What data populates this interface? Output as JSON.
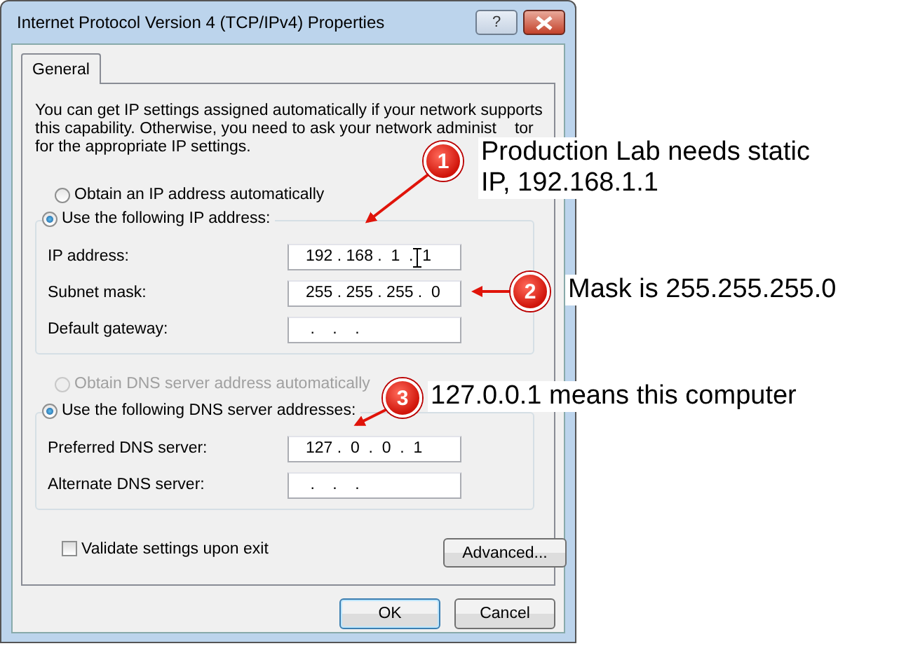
{
  "window": {
    "title": "Internet Protocol Version 4 (TCP/IPv4) Properties",
    "help_button": "?"
  },
  "tabs": [
    {
      "label": "General",
      "selected": true
    }
  ],
  "intro_lines": [
    [
      "You can get IP settings assigned automatically if your network supports"
    ],
    [
      "this capability. Otherwise, you need to ask your network administ",
      "tor"
    ],
    [
      "for the appropriate IP settings."
    ]
  ],
  "ip_mode": [
    {
      "label": "Obtain an IP address automatically",
      "selected": false,
      "disabled": false
    },
    {
      "label": "Use the following IP address:",
      "selected": true,
      "disabled": false
    }
  ],
  "ip_fields": [
    {
      "label": "IP address:",
      "value": "192 . 168 .  1  .  1",
      "cursor": true
    },
    {
      "label": "Subnet mask:",
      "value": "255 . 255 . 255 .  0",
      "cursor": false
    },
    {
      "label": "Default gateway:",
      "value": " .    .    . ",
      "cursor": false
    }
  ],
  "dns_mode": [
    {
      "label": "Obtain DNS server address automatically",
      "selected": false,
      "disabled": true
    },
    {
      "label": "Use the following DNS server addresses:",
      "selected": true,
      "disabled": false
    }
  ],
  "dns_fields": [
    {
      "label": "Preferred DNS server:",
      "value": "127 .  0  .  0  .  1",
      "cursor": false
    },
    {
      "label": "Alternate DNS server:",
      "value": " .    .    . ",
      "cursor": false
    }
  ],
  "validate": {
    "label": "Validate settings upon exit",
    "checked": false
  },
  "buttons": [
    {
      "label": "Advanced...",
      "kind": "advanced"
    },
    {
      "label": "OK",
      "kind": "default"
    },
    {
      "label": "Cancel",
      "kind": "normal"
    }
  ],
  "callouts": [
    {
      "number": "1",
      "text": "Production Lab needs static IP, 192.168.1.1"
    },
    {
      "number": "2",
      "text": "Mask is 255.255.255.0"
    },
    {
      "number": "3",
      "text": "127.0.0.1 means this computer"
    }
  ]
}
